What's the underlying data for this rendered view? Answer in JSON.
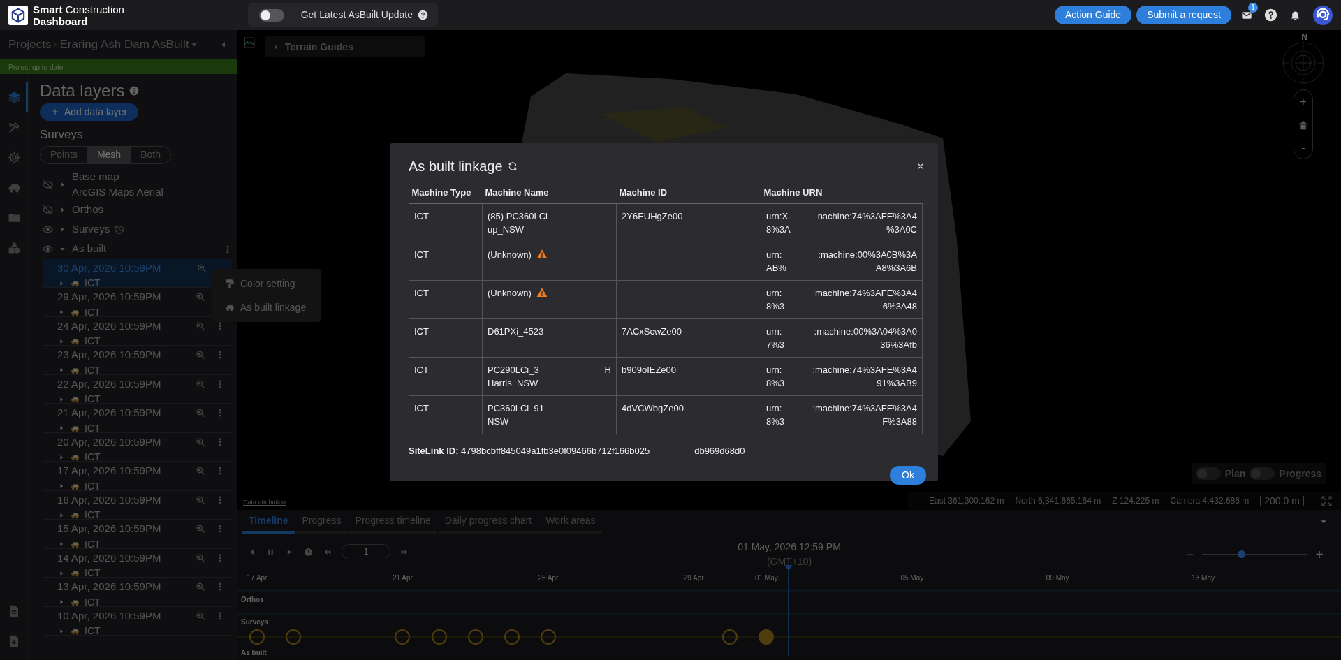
{
  "header": {
    "brand": "**Smart** Construction",
    "brand_sub": "Dashboard",
    "update_toggle": {
      "label": "Get Latest AsBuilt Update",
      "on": false
    },
    "actions": [
      "Action Guide",
      "Submit a request"
    ],
    "mail_badge": "1"
  },
  "breadcrumb": {
    "root": "Projects",
    "project": "Eraring Ash Dam AsBuilt"
  },
  "project_status": "Project up to date",
  "rail": [
    {
      "selected": true
    },
    {
      "selected": false
    },
    {
      "selected": false
    },
    {
      "selected": false
    },
    {
      "selected": false
    },
    {
      "selected": false
    }
  ],
  "panel": {
    "title": "Data layers",
    "add_button": "Add data layer",
    "surveys_label": "Surveys"
  },
  "modes": [
    {
      "label": "Points",
      "selected": false
    },
    {
      "label": "Mesh",
      "selected": true
    },
    {
      "label": "Both",
      "selected": false
    }
  ],
  "layers": [
    {
      "label": "Base map",
      "sublabel": "ArcGIS Maps Aerial",
      "visible": false,
      "expanded": false
    },
    {
      "label": "Orthos",
      "visible": false,
      "expanded": false
    },
    {
      "label": "Surveys",
      "visible": true,
      "expanded": false,
      "history": true
    },
    {
      "label": "As built",
      "visible": true,
      "expanded": true,
      "menu": true
    }
  ],
  "as_built_items": [
    {
      "date": "30 Apr, 2026 10:59PM",
      "machine": "ICT",
      "selected": true
    },
    {
      "date": "29 Apr, 2026 10:59PM",
      "machine": "ICT",
      "selected": false
    },
    {
      "date": "24 Apr, 2026 10:59PM",
      "machine": "ICT",
      "selected": false
    },
    {
      "date": "23 Apr, 2026 10:59PM",
      "machine": "ICT",
      "selected": false
    },
    {
      "date": "22 Apr, 2026 10:59PM",
      "machine": "ICT",
      "selected": false
    },
    {
      "date": "21 Apr, 2026 10:59PM",
      "machine": "ICT",
      "selected": false
    },
    {
      "date": "20 Apr, 2026 10:59PM",
      "machine": "ICT",
      "selected": false
    },
    {
      "date": "17 Apr, 2026 10:59PM",
      "machine": "ICT",
      "selected": false
    },
    {
      "date": "16 Apr, 2026 10:59PM",
      "machine": "ICT",
      "selected": false
    },
    {
      "date": "15 Apr, 2026 10:59PM",
      "machine": "ICT",
      "selected": false
    },
    {
      "date": "14 Apr, 2026 10:59PM",
      "machine": "ICT",
      "selected": false
    },
    {
      "date": "13 Apr, 2026 10:59PM",
      "machine": "ICT",
      "selected": false
    },
    {
      "date": "10 Apr, 2026 10:59PM",
      "machine": "ICT",
      "selected": false
    }
  ],
  "context_menu": [
    "Color setting",
    "As built linkage"
  ],
  "map": {
    "terrain_guides": "Terrain Guides",
    "compass": "N",
    "zoom_in": "+",
    "zoom_out": "-",
    "toggles": [
      {
        "label": "Plan",
        "on": false
      },
      {
        "label": "Progress",
        "on": false
      }
    ],
    "attribution": "Data attribution",
    "readouts": [
      "East 361,300.162 m",
      "North 6,341,665.164 m",
      "Z 124.225 m",
      "Camera 4,432.686 m"
    ],
    "scale": "200.0 m"
  },
  "timeline": {
    "tabs": [
      {
        "label": "Timeline",
        "selected": true
      },
      {
        "label": "Progress",
        "selected": false
      },
      {
        "label": "Progress timeline",
        "selected": false
      },
      {
        "label": "Daily progress chart",
        "selected": false
      },
      {
        "label": "Work areas",
        "selected": false
      }
    ],
    "step": "1",
    "date": "01 May, 2026 12:59 PM",
    "timezone": "(GMT+10)",
    "zoom_out": "−",
    "zoom_in": "+",
    "zoom": {
      "level": 0.37
    },
    "axis": [
      "17 Apr",
      "21 Apr",
      "25 Apr",
      "29 Apr",
      "01 May",
      "05 May",
      "09 May",
      "13 May"
    ],
    "rows": [
      "Orthos",
      "Surveys",
      "As built"
    ],
    "markers": [
      {
        "selected": false
      },
      {
        "selected": false
      },
      {
        "selected": false
      },
      {
        "selected": false
      },
      {
        "selected": false
      },
      {
        "selected": false
      },
      {
        "selected": false
      },
      {
        "selected": false
      },
      {
        "selected": true
      }
    ]
  },
  "modal": {
    "title": "As built linkage",
    "columns": [
      "Machine Type",
      "Machine Name",
      "Machine ID",
      "Machine URN"
    ],
    "rows": [
      {
        "type": "ICT",
        "name": [
          [
            "(85) PC360LCi_"
          ],
          [
            "up_NSW"
          ]
        ],
        "id": "2Y6EUHgZe00",
        "urn": [
          [
            "urn:X-",
            "nachine:74%3AFE%3A4"
          ],
          [
            "8%3A",
            "%3A0C"
          ]
        ]
      },
      {
        "type": "ICT",
        "name": [
          [
            "(Unknown)"
          ]
        ],
        "warning": true,
        "urn": [
          [
            "urn:",
            ":machine:00%3A0B%3A"
          ],
          [
            "AB%",
            "A8%3A6B"
          ]
        ]
      },
      {
        "type": "ICT",
        "name": [
          [
            "(Unknown)"
          ]
        ],
        "warning": true,
        "urn": [
          [
            "urn:",
            "machine:74%3AFE%3A4"
          ],
          [
            "8%3",
            "6%3A48"
          ]
        ]
      },
      {
        "type": "ICT",
        "name": [
          [
            "D61PXi_4523"
          ]
        ],
        "id": "7ACxScwZe00",
        "urn": [
          [
            "urn:",
            ":machine:00%3A04%3A0"
          ],
          [
            "7%3",
            "36%3Afb"
          ]
        ]
      },
      {
        "type": "ICT",
        "name": [
          [
            "PC290LCi_3",
            "H"
          ],
          [
            "Harris_NSW"
          ]
        ],
        "id": "b909oIEZe00",
        "urn": [
          [
            "urn:",
            ":machine:74%3AFE%3A4"
          ],
          [
            "8%3",
            "91%3AB9"
          ]
        ]
      },
      {
        "type": "ICT",
        "name": [
          [
            "PC360LCi_91"
          ],
          [
            "NSW"
          ]
        ],
        "id": "4dVCWbgZe00",
        "urn": [
          [
            "urn:",
            ":machine:74%3AFE%3A4"
          ],
          [
            "8%3",
            "F%3A88"
          ]
        ]
      }
    ],
    "sitelink_label": "SiteLink ID:",
    "sitelink": [
      "4798bcbff845049a1fb3e0f09466b712f166b025",
      "db969d68d0"
    ],
    "ok": "Ok"
  }
}
